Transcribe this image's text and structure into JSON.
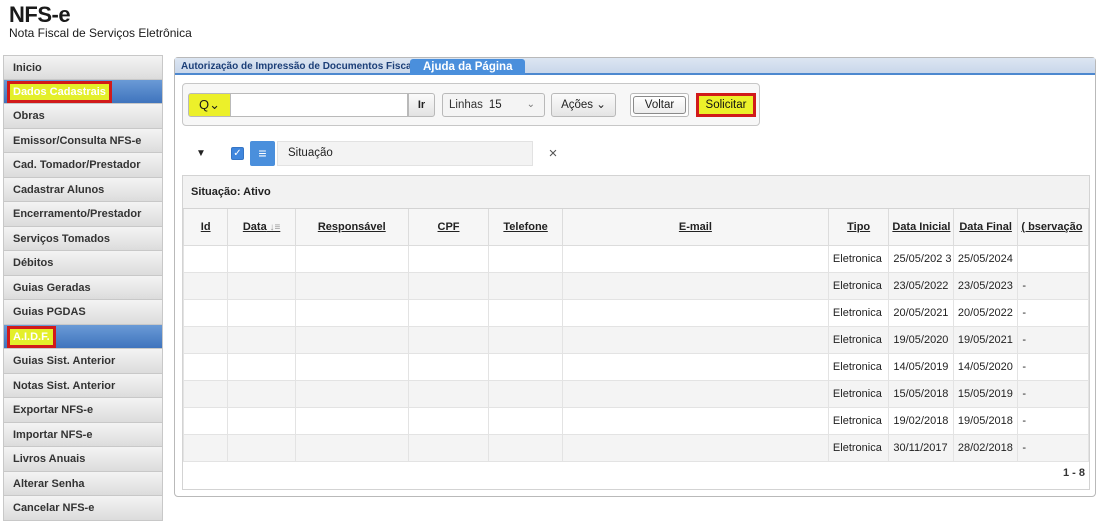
{
  "brand": {
    "title": "NFS-e",
    "subtitle": "Nota Fiscal de Serviços Eletrônica"
  },
  "sidebar": {
    "items": [
      {
        "label": "Inicio",
        "selected": false,
        "highlighted": false
      },
      {
        "label": "Dados Cadastrais",
        "selected": true,
        "highlighted": true
      },
      {
        "label": "Obras",
        "selected": false,
        "highlighted": false
      },
      {
        "label": "Emissor/Consulta NFS-e",
        "selected": false,
        "highlighted": false
      },
      {
        "label": "Cad. Tomador/Prestador",
        "selected": false,
        "highlighted": false
      },
      {
        "label": "Cadastrar Alunos",
        "selected": false,
        "highlighted": false
      },
      {
        "label": "Encerramento/Prestador",
        "selected": false,
        "highlighted": false
      },
      {
        "label": "Serviços Tomados",
        "selected": false,
        "highlighted": false
      },
      {
        "label": "Débitos",
        "selected": false,
        "highlighted": false
      },
      {
        "label": "Guias Geradas",
        "selected": false,
        "highlighted": false
      },
      {
        "label": "Guias PGDAS",
        "selected": false,
        "highlighted": false
      },
      {
        "label": "A.I.D.F.",
        "selected": true,
        "highlighted": true
      },
      {
        "label": "Guias Sist. Anterior",
        "selected": false,
        "highlighted": false
      },
      {
        "label": "Notas Sist. Anterior",
        "selected": false,
        "highlighted": false
      },
      {
        "label": "Exportar NFS-e",
        "selected": false,
        "highlighted": false
      },
      {
        "label": "Importar NFS-e",
        "selected": false,
        "highlighted": false
      },
      {
        "label": "Livros Anuais",
        "selected": false,
        "highlighted": false
      },
      {
        "label": "Alterar Senha",
        "selected": false,
        "highlighted": false
      },
      {
        "label": "Cancelar NFS-e",
        "selected": false,
        "highlighted": false
      }
    ]
  },
  "tabs": {
    "breadcrumb": "Autorização de Impressão de Documentos Fiscais",
    "active": "Ajuda da Página"
  },
  "toolbar": {
    "search_icon": "Q⌄",
    "search_value": "",
    "go_label": "Ir",
    "rows_label": "Linhas",
    "rows_value": "15",
    "actions_label": "Ações",
    "back_label": "Voltar",
    "request_label": "Solicitar"
  },
  "filter": {
    "label": "Situação"
  },
  "table": {
    "group_label": "Situação: Ativo",
    "columns": [
      "Id",
      "Data",
      "Responsável",
      "CPF",
      "Telefone",
      "E-mail",
      "Tipo",
      "Data Inicial",
      "Data Final",
      "( bservação"
    ],
    "rows": [
      [
        "",
        "",
        "",
        "",
        "",
        "",
        "Eletronica",
        "25/05/202 3",
        "25/05/2024",
        ""
      ],
      [
        "",
        "",
        "",
        "",
        "",
        "",
        "Eletronica",
        "23/05/2022",
        "23/05/2023",
        "-"
      ],
      [
        "",
        "",
        "",
        "",
        "",
        "",
        "Eletronica",
        "20/05/2021",
        "20/05/2022",
        "-"
      ],
      [
        "",
        "",
        "",
        "",
        "",
        "",
        "Eletronica",
        "19/05/2020",
        "19/05/2021",
        "-"
      ],
      [
        "",
        "",
        "",
        "",
        "",
        "",
        "Eletronica",
        "14/05/2019",
        "14/05/2020",
        "-"
      ],
      [
        "",
        "",
        "",
        "",
        "",
        "",
        "Eletronica",
        "15/05/2018",
        "15/05/2019",
        "-"
      ],
      [
        "",
        "",
        "",
        "",
        "",
        "",
        "Eletronica",
        "19/02/2018",
        "19/05/2018",
        "-"
      ],
      [
        "",
        "",
        "",
        "",
        "",
        "",
        "Eletronica",
        "30/11/2017",
        "28/02/2018",
        "-"
      ]
    ],
    "pagination": "1 - 8"
  },
  "colors": {
    "accent": "#4a8fdc",
    "highlight_fill": "#ecf02a",
    "highlight_border": "#d11a1a"
  }
}
